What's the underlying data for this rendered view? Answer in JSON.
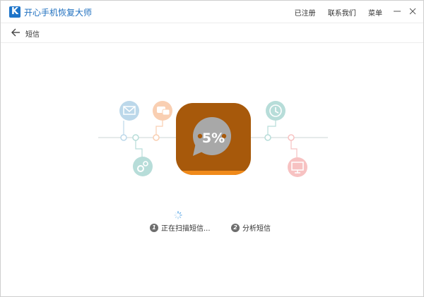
{
  "app": {
    "logo_letter": "K",
    "title": "开心手机恢复大师"
  },
  "header": {
    "links": [
      "已注册",
      "联系我们",
      "菜单"
    ]
  },
  "subheader": {
    "title": "短信"
  },
  "progress": {
    "percent_text": "5%",
    "percent_value": 5
  },
  "steps": [
    {
      "number": "1",
      "label": "正在扫描短信..."
    },
    {
      "number": "2",
      "label": "分析短信"
    }
  ],
  "colors": {
    "brand_blue": "#1d74c9",
    "center_box": "#a7590b",
    "center_bar": "#f08a1a",
    "teal_icon": "#b7ddd9",
    "orange_icon": "#f9cfb2",
    "blue_icon": "#bcd8ea",
    "pink_icon": "#f7c2c2"
  },
  "icons": [
    "mail-icon",
    "chat-icon",
    "settings-icon",
    "clock-icon",
    "monitor-icon"
  ]
}
